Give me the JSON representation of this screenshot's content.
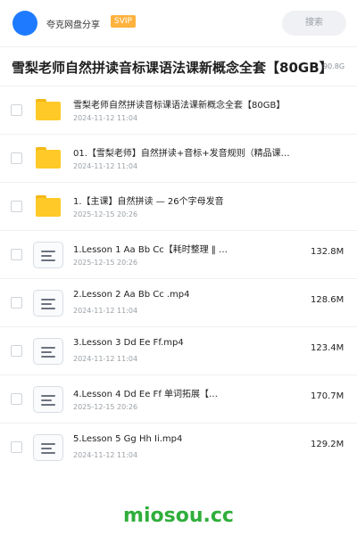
{
  "header": {
    "share_name": "夸克网盘分享",
    "badge": "SVIP",
    "search_label": "搜索",
    "accent_color": "#1e7bff",
    "badge_color": "#ffb23e"
  },
  "title_bar": {
    "title": "雪梨老师自然拼读音标课语法课新概念全套【80GB】",
    "total_size": "90.8G"
  },
  "files": [
    {
      "type": "folder",
      "name": "雪梨老师自然拼读音标课语法课新概念全套【80GB】",
      "date": "2024-11-12 11:04",
      "size": ""
    },
    {
      "type": "folder",
      "name": "01.【雪梨老师】自然拼读+音标+发音规则（精品课…",
      "date": "2024-11-12 11:04",
      "size": ""
    },
    {
      "type": "folder",
      "name": "1.【主课】自然拼读 — 26个字母发音",
      "date": "2025-12-15 20:26",
      "size": ""
    },
    {
      "type": "file",
      "name": "1.Lesson 1 Aa Bb Cc【耗时整理 ‖ …",
      "date": "2025-12-15 20:26",
      "size": "132.8M"
    },
    {
      "type": "file",
      "name": "2.Lesson 2 Aa Bb Cc .mp4",
      "date": "2024-11-12 11:04",
      "size": "128.6M"
    },
    {
      "type": "file",
      "name": "3.Lesson 3 Dd Ee Ff.mp4",
      "date": "2024-11-12 11:04",
      "size": "123.4M"
    },
    {
      "type": "file",
      "name": "4.Lesson 4 Dd Ee Ff 单词拓展【…",
      "date": "2025-12-15 20:26",
      "size": "170.7M"
    },
    {
      "type": "file",
      "name": "5.Lesson 5 Gg Hh Ii.mp4",
      "date": "2024-11-12 11:04",
      "size": "129.2M"
    }
  ],
  "footer": {
    "watermark": "miosou.cc",
    "watermark_color": "#2fae3b"
  }
}
